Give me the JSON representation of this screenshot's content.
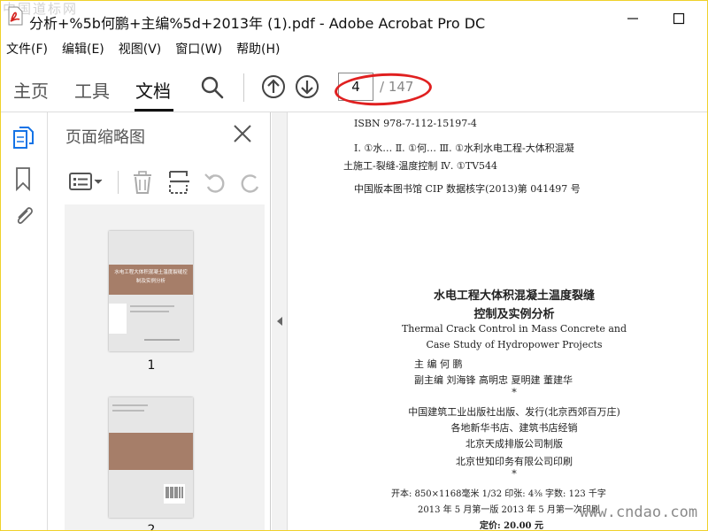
{
  "window": {
    "title": "分析+%5b何鹏+主编%5d+2013年 (1).pdf - Adobe Acrobat Pro DC",
    "watermark_top": "中国道标网"
  },
  "menu": [
    "文件(F)",
    "编辑(E)",
    "视图(V)",
    "窗口(W)",
    "帮助(H)"
  ],
  "toolbar": {
    "tabs": [
      "主页",
      "工具",
      "文档"
    ],
    "active_tab": "文档",
    "page_current": "4",
    "page_total": "/ 147"
  },
  "panel": {
    "title": "页面缩略图",
    "thumbnails": [
      {
        "label": "1",
        "cover_title": "水电工程大体积混凝土温度裂缝控制及实例分析"
      },
      {
        "label": "2"
      }
    ]
  },
  "document": {
    "isbn": "ISBN 978-7-112-15197-4",
    "cip_line1": "Ⅰ. ①水…  Ⅱ. ①何…  Ⅲ. ①水利水电工程-大体积混凝",
    "cip_line2": "土施工-裂缝-温度控制  Ⅳ. ①TV544",
    "cip_line3": "中国版本图书馆 CIP 数据核字(2013)第 041497 号",
    "title_cn_1": "水电工程大体积混凝土温度裂缝",
    "title_cn_2": "控制及实例分析",
    "title_en_1": "Thermal Crack Control in Mass Concrete and",
    "title_en_2": "Case Study of Hydropower Projects",
    "editor": "主  编  何  鹏",
    "deputy_editor": "副主编  刘海锋  高明忠  夏明建  董建华",
    "star": "*",
    "publisher": "中国建筑工业出版社出版、发行(北京西郊百万庄)",
    "distributor": "各地新华书店、建筑书店经销",
    "typesetter": "北京天成排版公司制版",
    "printer": "北京世知印务有限公司印刷",
    "star2": "*",
    "specs": "开本: 850×1168毫米  1/32  印张: 4⅜  字数: 123 千字",
    "edition": "2013 年 5 月第一版     2013 年 5 月第一次印刷",
    "price": "定价: 20.00 元"
  },
  "watermark_bottom": "www.cndao.com"
}
